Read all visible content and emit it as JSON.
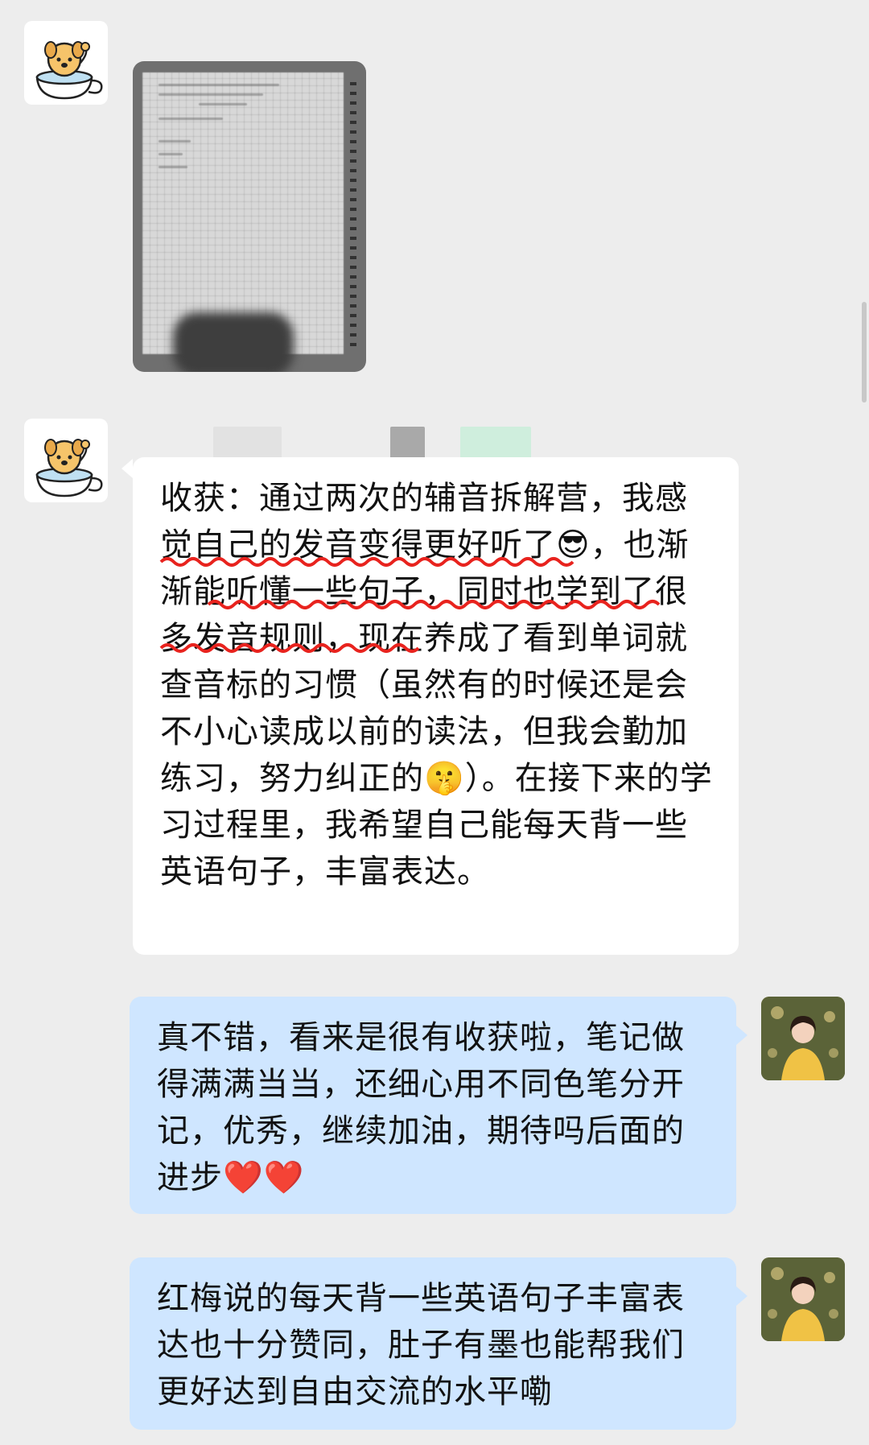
{
  "messages": [
    {
      "sender": "left",
      "type": "image",
      "image_description_icon": "notebook-photo"
    },
    {
      "sender": "left",
      "type": "text",
      "text": "收获：通过两次的辅音拆解营，我感觉自己的发音变得更好听了😎，也渐渐能听懂一些句子，同时也学到了很多发音规则，现在养成了看到单词就查音标的习惯（虽然有的时候还是会不小心读成以前的读法，但我会勤加练习，努力纠正的🤫）。在接下来的学习过程里，我希望自己能每天背一些英语句子，丰富表达。"
    },
    {
      "sender": "right",
      "type": "text",
      "text": "真不错，看来是很有收获啦，笔记做得满满当当，还细心用不同色笔分开记，优秀，继续加油，期待吗后面的进步❤️❤️"
    },
    {
      "sender": "right",
      "type": "text",
      "text": "红梅说的每天背一些英语句子丰富表达也十分赞同，肚子有墨也能帮我们更好达到自由交流的水平嘞"
    }
  ],
  "colors": {
    "background": "#ededed",
    "left_bubble": "#ffffff",
    "right_bubble": "#cfe6ff",
    "underline": "#e8231e"
  },
  "icons": {
    "left_avatar": "dog-in-teacup-icon",
    "right_avatar": "profile-photo-avatar"
  }
}
